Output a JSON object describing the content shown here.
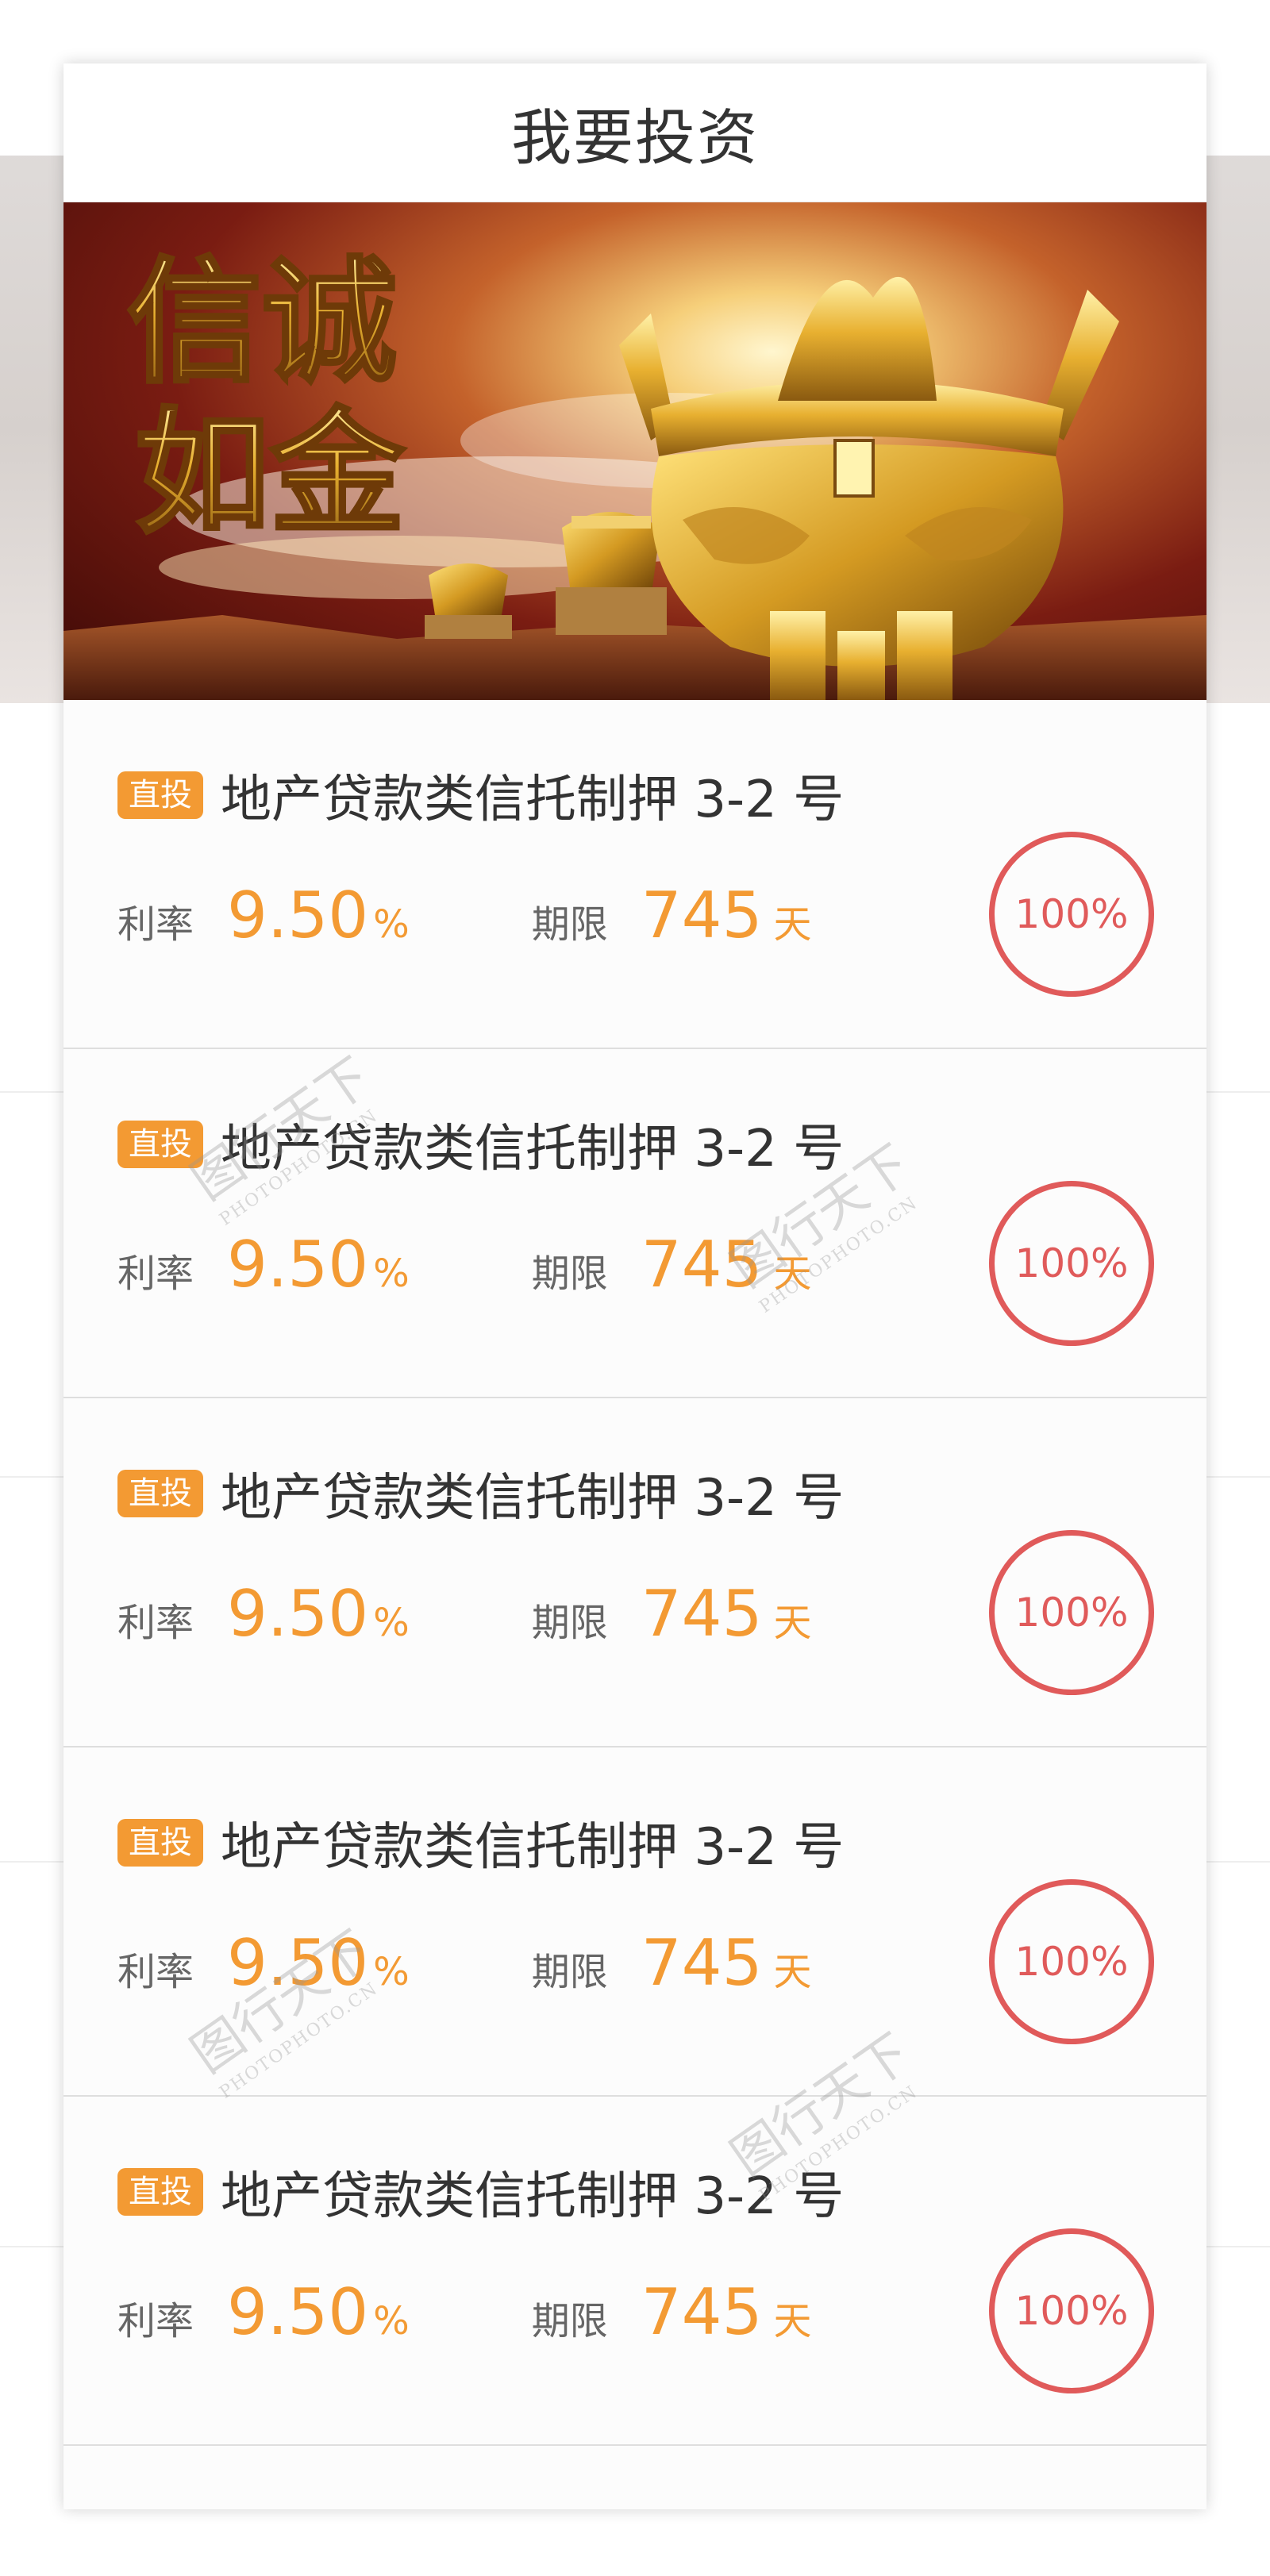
{
  "page": {
    "title": "我要投资"
  },
  "banner": {
    "slogan_line1": "信诚",
    "slogan_line2": "如金"
  },
  "labels": {
    "rate": "利率",
    "term": "期限",
    "rate_unit": "%",
    "term_unit": "天"
  },
  "products": [
    {
      "badge": "直投",
      "name": "地产贷款类信托制押 3-2 号",
      "rate": "9.50",
      "term": "745",
      "progress": "100%"
    },
    {
      "badge": "直投",
      "name": "地产贷款类信托制押 3-2 号",
      "rate": "9.50",
      "term": "745",
      "progress": "100%"
    },
    {
      "badge": "直投",
      "name": "地产贷款类信托制押 3-2 号",
      "rate": "9.50",
      "term": "745",
      "progress": "100%"
    },
    {
      "badge": "直投",
      "name": "地产贷款类信托制押 3-2 号",
      "rate": "9.50",
      "term": "745",
      "progress": "100%"
    },
    {
      "badge": "直投",
      "name": "地产贷款类信托制押 3-2 号",
      "rate": "9.50",
      "term": "745",
      "progress": "100%"
    }
  ],
  "watermark": {
    "text": "图行天下",
    "sub": "PHOTOPHOTO.CN"
  },
  "colors": {
    "accent": "#f39a33",
    "progress_ring": "#e05a5a",
    "title_text": "#333333"
  }
}
